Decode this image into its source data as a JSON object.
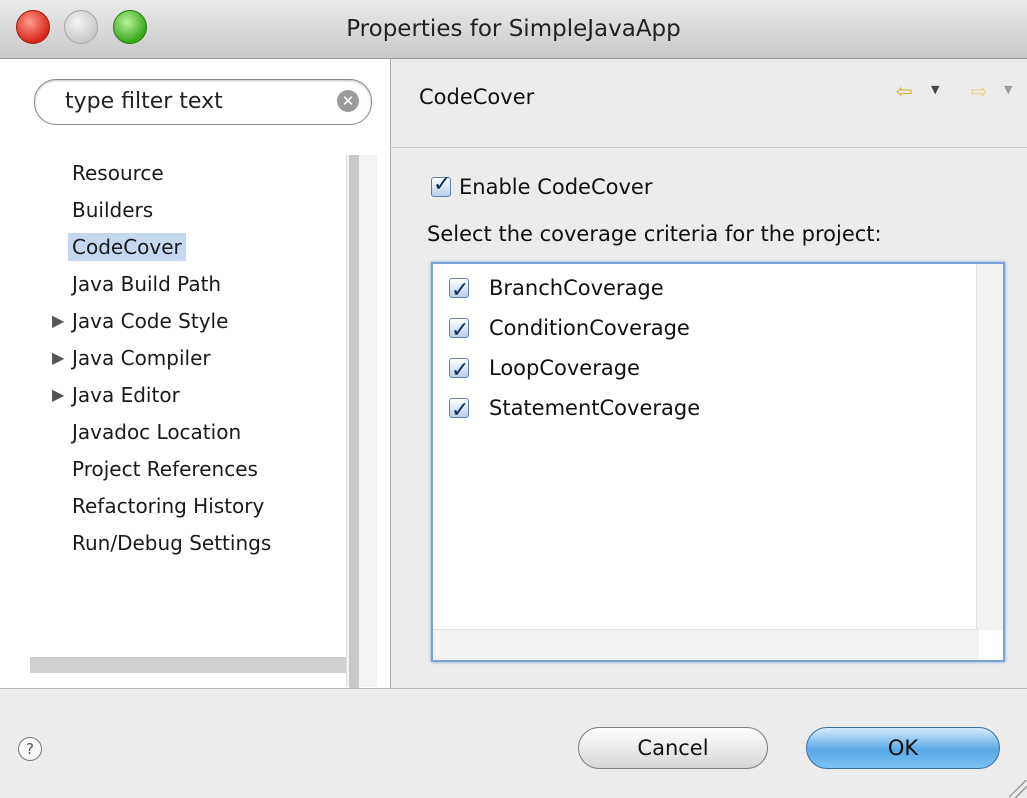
{
  "window": {
    "title": "Properties for SimpleJavaApp"
  },
  "sidebar": {
    "filter": {
      "placeholder": "type filter text"
    },
    "items": [
      {
        "label": "Resource",
        "expandable": false,
        "selected": false
      },
      {
        "label": "Builders",
        "expandable": false,
        "selected": false
      },
      {
        "label": "CodeCover",
        "expandable": false,
        "selected": true
      },
      {
        "label": "Java Build Path",
        "expandable": false,
        "selected": false
      },
      {
        "label": "Java Code Style",
        "expandable": true,
        "selected": false
      },
      {
        "label": "Java Compiler",
        "expandable": true,
        "selected": false
      },
      {
        "label": "Java Editor",
        "expandable": true,
        "selected": false
      },
      {
        "label": "Javadoc Location",
        "expandable": false,
        "selected": false
      },
      {
        "label": "Project References",
        "expandable": false,
        "selected": false
      },
      {
        "label": "Refactoring History",
        "expandable": false,
        "selected": false
      },
      {
        "label": "Run/Debug Settings",
        "expandable": false,
        "selected": false
      }
    ]
  },
  "page": {
    "title": "CodeCover",
    "enable": {
      "label": "Enable CodeCover",
      "checked": true
    },
    "criteria_label": "Select the coverage criteria for the project:",
    "criteria": [
      {
        "label": "BranchCoverage",
        "checked": true
      },
      {
        "label": "ConditionCoverage",
        "checked": true
      },
      {
        "label": "LoopCoverage",
        "checked": true
      },
      {
        "label": "StatementCoverage",
        "checked": true
      }
    ]
  },
  "buttons": {
    "cancel": "Cancel",
    "ok": "OK",
    "help": "?"
  },
  "colors": {
    "selection": "#c6d8f0",
    "default_button": "#5aa8e6",
    "list_focus": "#7aa2d6"
  }
}
